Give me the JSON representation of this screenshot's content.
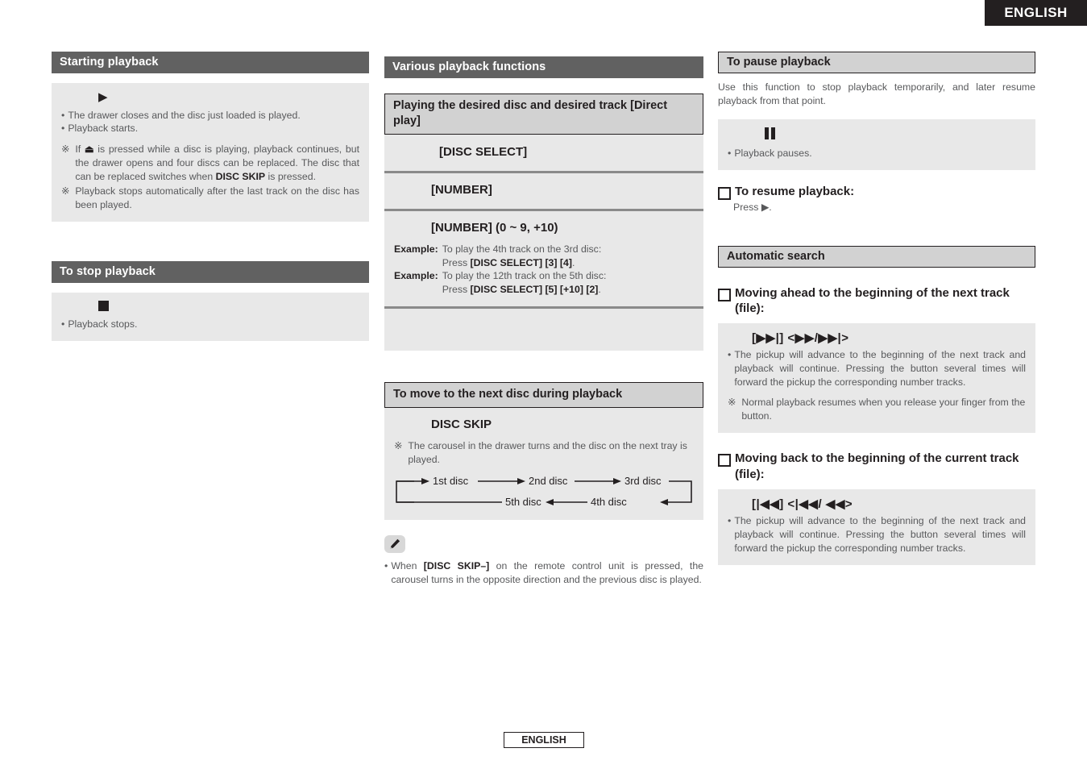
{
  "header": {
    "language_tab": "ENGLISH"
  },
  "footer": {
    "language_tab": "ENGLISH"
  },
  "col1": {
    "section1": {
      "banner": "Starting playback",
      "key_symbol": "▶",
      "bullets": [
        "The drawer closes and the disc just loaded is played.",
        "Playback starts."
      ],
      "note1_pre": "If ",
      "note1_sym": "⏏",
      "note1_mid": " is pressed while a disc is playing, playback continues, but the drawer opens and four discs can be replaced. The disc that can be replaced switches when ",
      "note1_bold": "DISC SKIP",
      "note1_post": " is pressed.",
      "note2": "Playback stops automatically after the last track on the disc has been played."
    },
    "section2": {
      "banner": "To stop playback",
      "key_symbol": "■",
      "bullets": [
        "Playback stops."
      ]
    }
  },
  "col2": {
    "banner": "Various playback functions",
    "subhead": "Playing the desired disc and desired track [Direct play]",
    "rows": [
      {
        "key": "[DISC SELECT]"
      },
      {
        "key": "[NUMBER]"
      },
      {
        "key": "[NUMBER] (0 ~ 9, +10)"
      }
    ],
    "examples": [
      {
        "label": "Example:",
        "line1": "To play the 4th track on the 3rd disc:",
        "line2_pre": "Press ",
        "line2_bold": "[DISC SELECT] [3] [4]",
        "line2_post": "."
      },
      {
        "label": "Example:",
        "line1": "To play the 12th track on the 5th disc:",
        "line2_pre": "Press ",
        "line2_bold": "[DISC SELECT] [5] [+10] [2]",
        "line2_post": "."
      }
    ],
    "section2": {
      "subhead": "To move to the next disc during playback",
      "key": "DISC SKIP",
      "note": "The carousel in the drawer turns and the disc on the next tray is played.",
      "diagram": {
        "top_row": [
          "1st disc",
          "2nd disc",
          "3rd disc"
        ],
        "bottom_row": [
          "5th disc",
          "4th disc"
        ]
      }
    },
    "memo": {
      "icon": "pencil-icon",
      "text_pre": "When ",
      "text_bold": "[DISC SKIP–]",
      "text_post": " on the remote control unit is pressed, the carousel turns in the opposite direction and the previous disc is played."
    }
  },
  "col3": {
    "section1": {
      "banner": "To pause playback",
      "intro": "Use this function to stop playback temporarily, and later resume playback from that point.",
      "key_symbol": "❚❚",
      "bullets": [
        "Playback pauses."
      ],
      "resume_head": "To resume playback:",
      "resume_body": "Press ▶."
    },
    "section2": {
      "banner": "Automatic search",
      "item1": {
        "head": "Moving ahead to the beginning of the next track (file):",
        "keys": "[▶▶|]    <▶▶/▶▶|>",
        "bullet": "The pickup will advance to the beginning of the next track and playback will continue. Pressing the button several times will forward the pickup the corresponding number tracks.",
        "note": "Normal playback resumes when you release your finger from the button."
      },
      "item2": {
        "head": "Moving back to the beginning of the current track (file):",
        "keys": "[|◀◀]    <|◀◀/ ◀◀>",
        "bullet": "The pickup will advance to the beginning of the next track and playback will continue. Pressing the button several times will forward the pickup the corresponding number tracks."
      }
    }
  },
  "colors": {
    "banner_dark": "#616161",
    "banner_light": "#d2d2d2",
    "panel": "#e8e8e8",
    "rule": "#8a8a8a",
    "ink": "#231f20",
    "body_text": "#58595b",
    "tab_dark": "#231f20"
  }
}
